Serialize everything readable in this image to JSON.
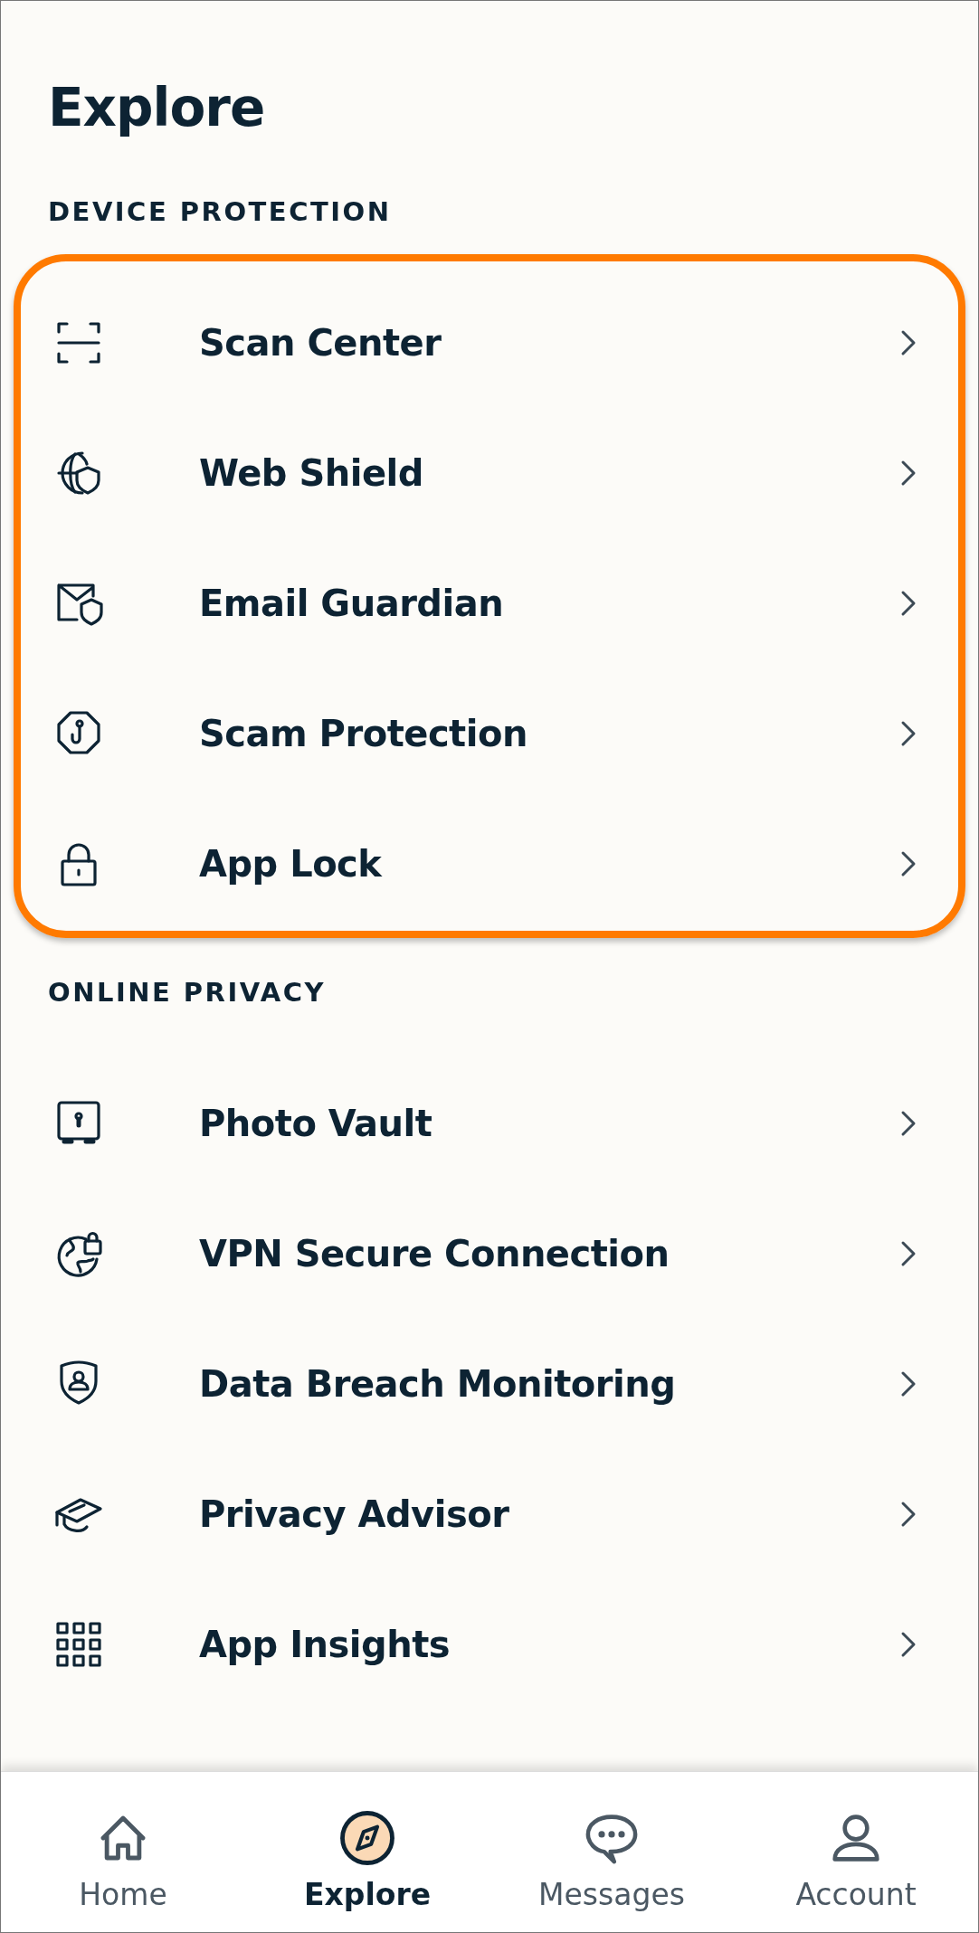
{
  "title": "Explore",
  "sections": [
    {
      "heading": "DEVICE PROTECTION",
      "highlighted": true,
      "items": [
        {
          "label": "Scan Center"
        },
        {
          "label": "Web Shield"
        },
        {
          "label": "Email Guardian"
        },
        {
          "label": "Scam Protection"
        },
        {
          "label": "App Lock"
        }
      ]
    },
    {
      "heading": "ONLINE PRIVACY",
      "highlighted": false,
      "items": [
        {
          "label": "Photo Vault"
        },
        {
          "label": "VPN Secure Connection"
        },
        {
          "label": "Data Breach Monitoring"
        },
        {
          "label": "Privacy Advisor"
        },
        {
          "label": "App Insights"
        }
      ]
    }
  ],
  "nav": [
    {
      "label": "Home",
      "selected": false
    },
    {
      "label": "Explore",
      "selected": true
    },
    {
      "label": "Messages",
      "selected": false
    },
    {
      "label": "Account",
      "selected": false
    }
  ]
}
